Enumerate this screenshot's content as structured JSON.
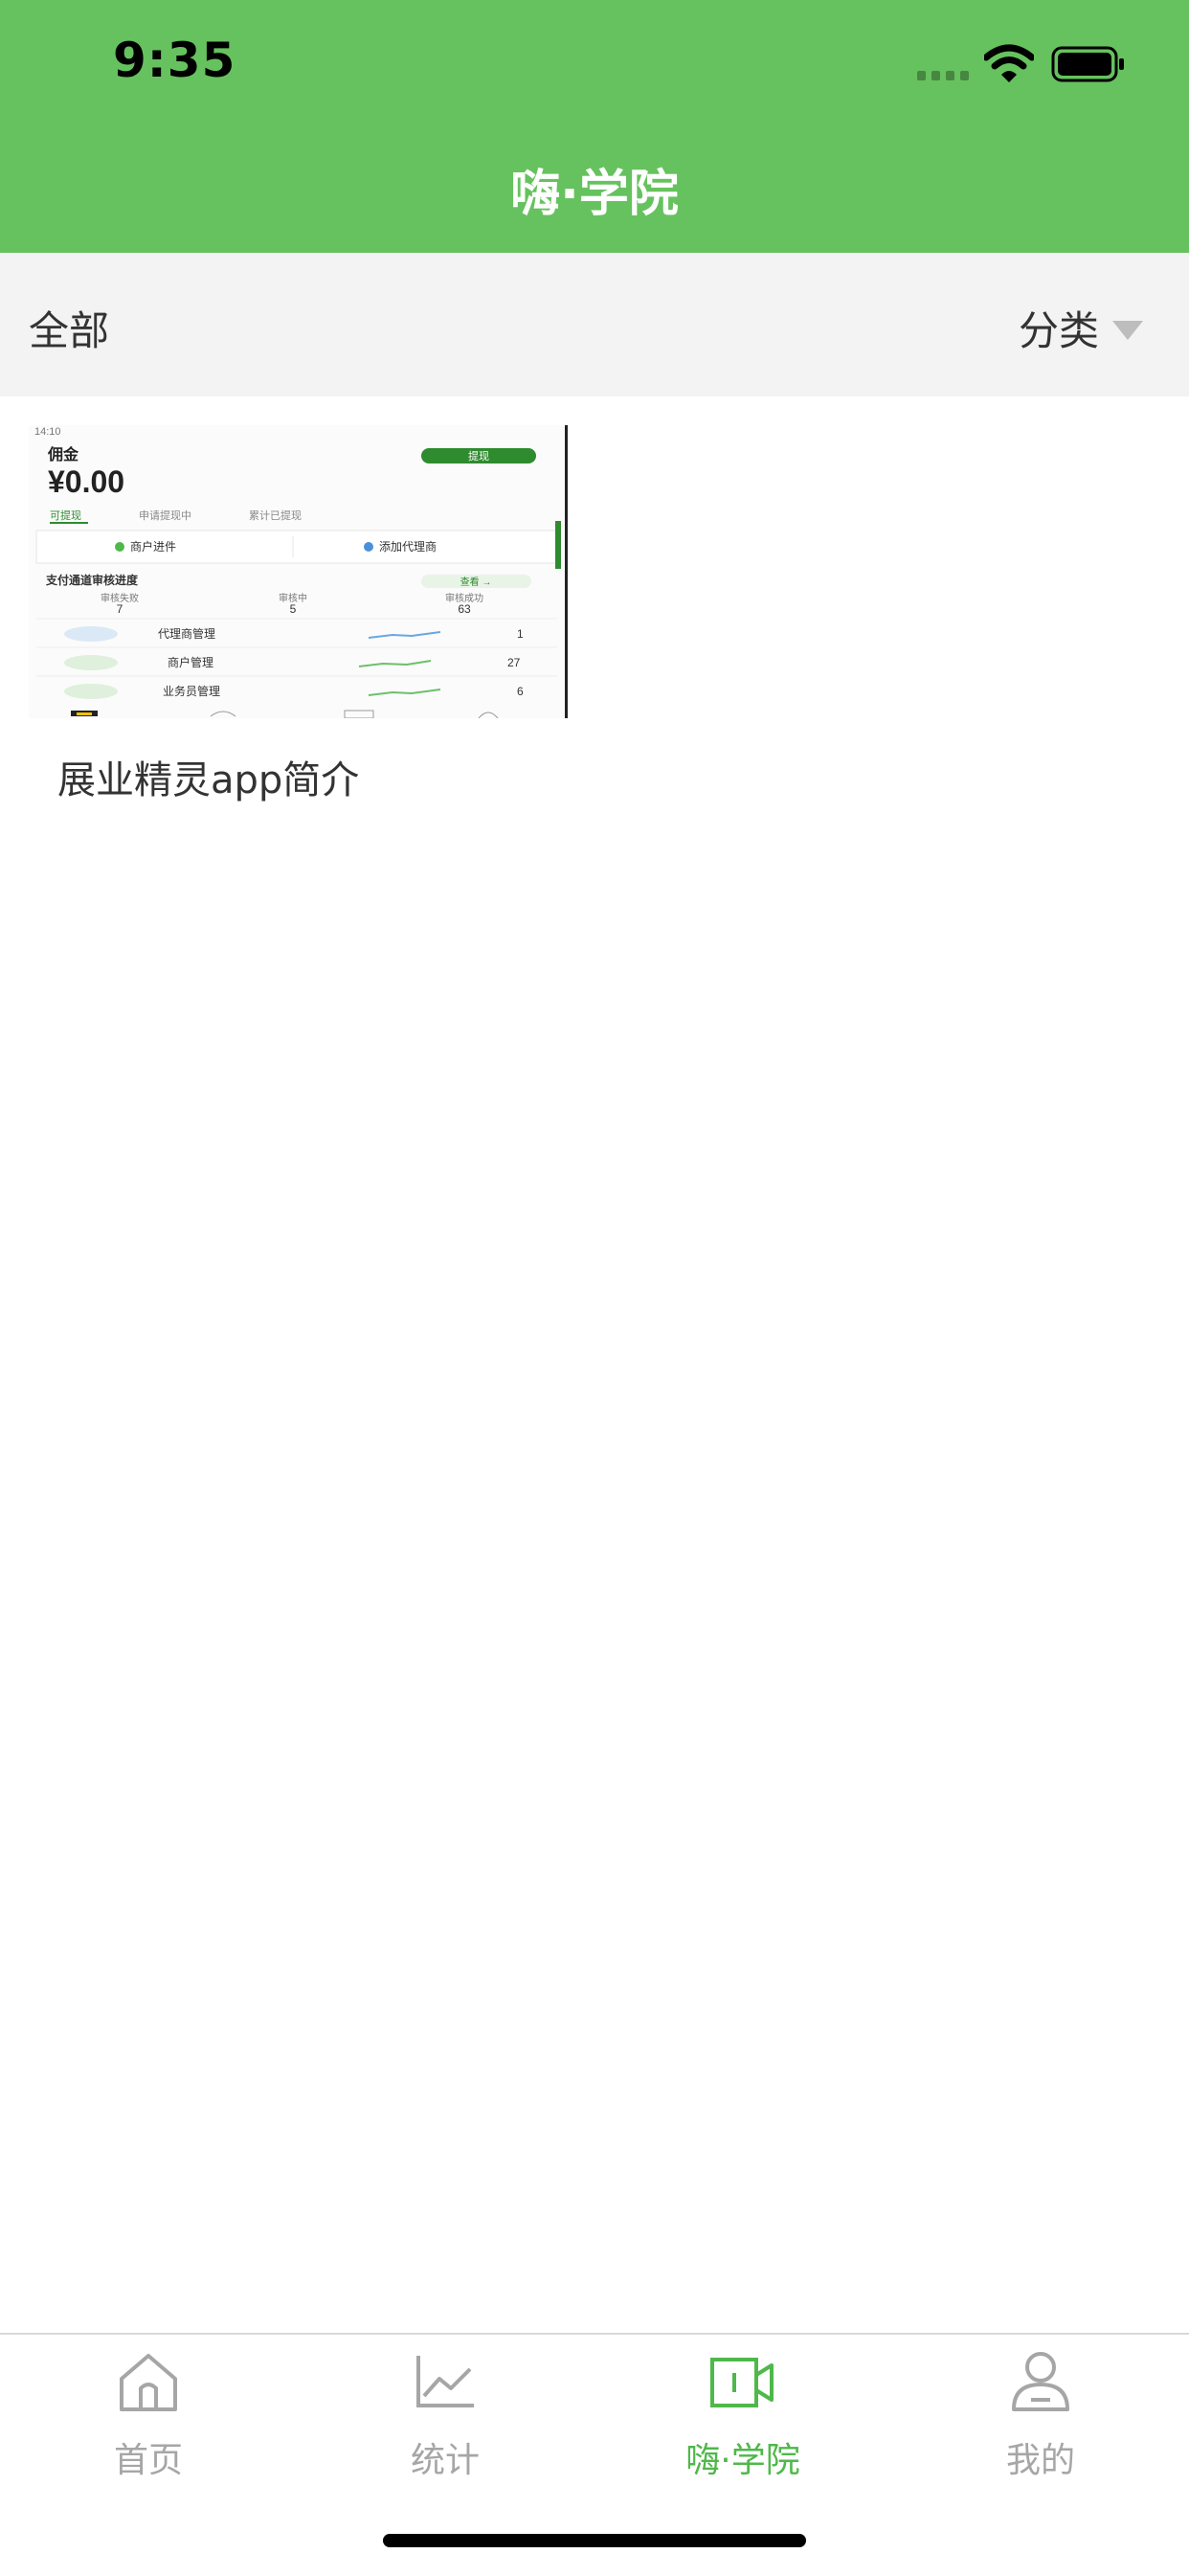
{
  "status_bar": {
    "time": "9:35"
  },
  "nav": {
    "title": "嗨·学院"
  },
  "filter": {
    "all_label": "全部",
    "category_label": "分类"
  },
  "videos": [
    {
      "title": "展业精灵app简介",
      "thumbnail": {
        "status_text": "14:10",
        "balance_label": "佣金",
        "balance_value": "¥0.00",
        "withdraw_label": "提现",
        "tabs": [
          "可提现",
          "申请提现中",
          "累计已提现"
        ],
        "actions": [
          "商户进件",
          "添加代理商"
        ],
        "progress_title": "支付通道审核进度",
        "progress_link": "查看 →",
        "progress_stats": [
          {
            "label": "审核失败",
            "value": "7"
          },
          {
            "label": "审核中",
            "value": "5"
          },
          {
            "label": "审核成功",
            "value": "63"
          }
        ],
        "rows": [
          {
            "label": "代理商管理",
            "value": "1"
          },
          {
            "label": "商户管理",
            "value": "27"
          },
          {
            "label": "业务员管理",
            "value": "6"
          }
        ]
      }
    }
  ],
  "tabbar": {
    "items": [
      {
        "label": "首页",
        "icon": "home-icon"
      },
      {
        "label": "统计",
        "icon": "chart-icon"
      },
      {
        "label": "嗨·学院",
        "icon": "video-icon",
        "active": true
      },
      {
        "label": "我的",
        "icon": "user-icon"
      }
    ]
  },
  "colors": {
    "brand_green": "#66c25e",
    "active_tab": "#4fb84a",
    "inactive_tab": "#a6a6a6"
  }
}
